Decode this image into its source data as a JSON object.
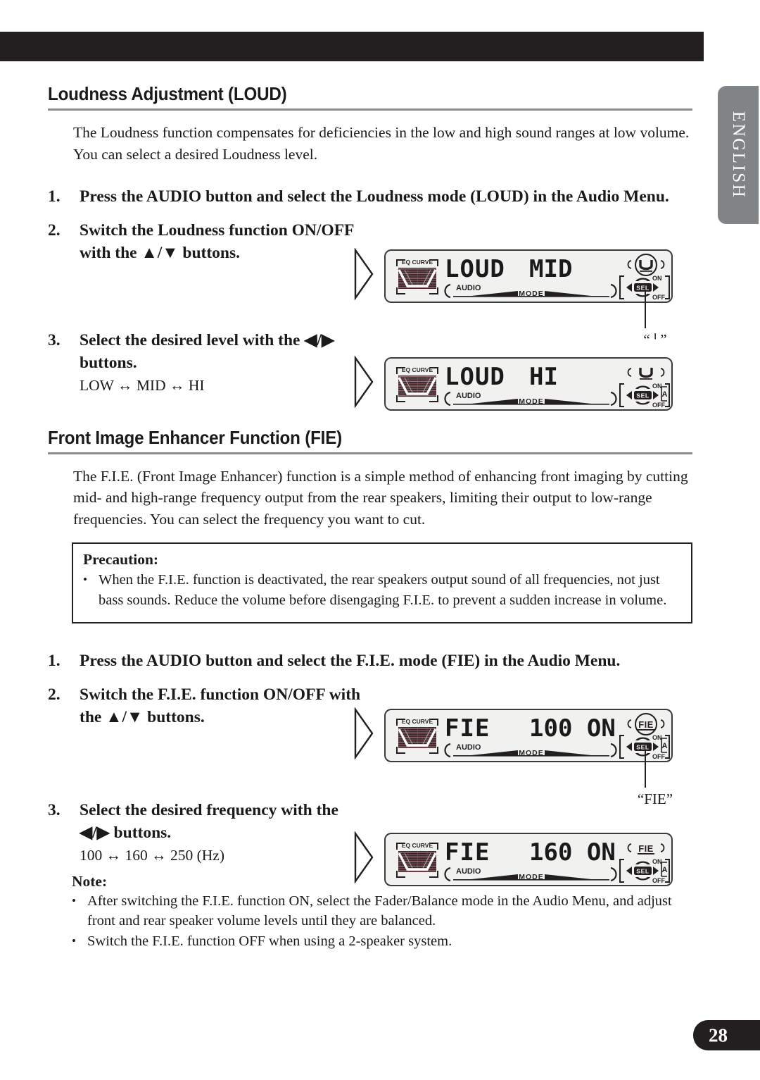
{
  "page": {
    "number": "28",
    "language_tab": "ENGLISH"
  },
  "sections": [
    {
      "heading": "Loudness Adjustment (LOUD)",
      "intro": "The Loudness function compensates for deficiencies in the low and high sound ranges at low volume. You can select a desired Loudness level.",
      "steps": [
        {
          "num": "1.",
          "text": "Press the AUDIO button and select the Loudness mode (LOUD) in the Audio Menu."
        },
        {
          "num": "2.",
          "text": "Switch the Loudness function ON/OFF with the ▲/▼ buttons."
        },
        {
          "num": "3.",
          "text": "Select the desired level with the ◀/▶ buttons.",
          "options": "LOW ↔ MID ↔ HI"
        }
      ]
    },
    {
      "heading": "Front Image Enhancer Function (FIE)",
      "intro": "The F.I.E. (Front Image Enhancer) function is a simple method of enhancing front imaging by cutting mid- and high-range frequency output from the rear speakers, limiting their output to low-range frequencies. You can select the frequency you want to cut.",
      "precaution": {
        "title": "Precaution:",
        "bullets": [
          "When the F.I.E. function is deactivated, the rear speakers output sound of all frequencies, not just bass sounds. Reduce the volume before disengaging F.I.E. to prevent a sudden increase in volume."
        ]
      },
      "steps": [
        {
          "num": "1.",
          "text": "Press the AUDIO button and select the F.I.E. mode (FIE) in the Audio Menu."
        },
        {
          "num": "2.",
          "text": "Switch the F.I.E. function ON/OFF with the ▲/▼ buttons."
        },
        {
          "num": "3.",
          "text": "Select the desired frequency with the ◀/▶ buttons.",
          "options": "100 ↔ 160 ↔ 250 (Hz)"
        }
      ],
      "note": {
        "title": "Note:",
        "bullets": [
          "After switching the F.I.E. function ON, select the Fader/Balance mode in the Audio Menu, and adjust front and rear speaker volume levels until they are balanced.",
          "Switch the F.I.E. function OFF when using a 2-speaker system."
        ]
      }
    }
  ],
  "displays": [
    {
      "id": "loud-mid",
      "eq_label": "EQ CURVE",
      "main_text": "LOUD",
      "value_text": "MID",
      "audio_label": "AUDIO",
      "mode_label": "MODE",
      "sel_label": "SEL",
      "on_label": "ON",
      "off_label": "OFF",
      "indicator": "loudness",
      "indicator_circled": true,
      "show_a_indicator": false,
      "callout_caption": "“ ᑊ ”"
    },
    {
      "id": "loud-hi",
      "eq_label": "EQ CURVE",
      "main_text": "LOUD",
      "value_text": "HI",
      "audio_label": "AUDIO",
      "mode_label": "MODE",
      "sel_label": "SEL",
      "on_label": "ON",
      "off_label": "OFF",
      "indicator": "loudness",
      "indicator_circled": false,
      "show_a_indicator": true,
      "callout_caption": ""
    },
    {
      "id": "fie-100",
      "eq_label": "EQ CURVE",
      "main_text": "FIE",
      "value_text": "100 ON",
      "audio_label": "AUDIO",
      "mode_label": "MODE",
      "sel_label": "SEL",
      "on_label": "ON",
      "off_label": "OFF",
      "indicator": "FIE",
      "indicator_circled": true,
      "show_a_indicator": true,
      "callout_caption": "“FIE”"
    },
    {
      "id": "fie-160",
      "eq_label": "EQ CURVE",
      "main_text": "FIE",
      "value_text": "160 ON",
      "audio_label": "AUDIO",
      "mode_label": "MODE",
      "sel_label": "SEL",
      "on_label": "ON",
      "off_label": "OFF",
      "indicator": "FIE",
      "indicator_circled": false,
      "show_a_indicator": true,
      "callout_caption": ""
    }
  ],
  "colors": {
    "bar": "#231f20",
    "tab": "#808487",
    "rule": "#8a8d8f",
    "lcd_bg": "#f1f1f0"
  }
}
